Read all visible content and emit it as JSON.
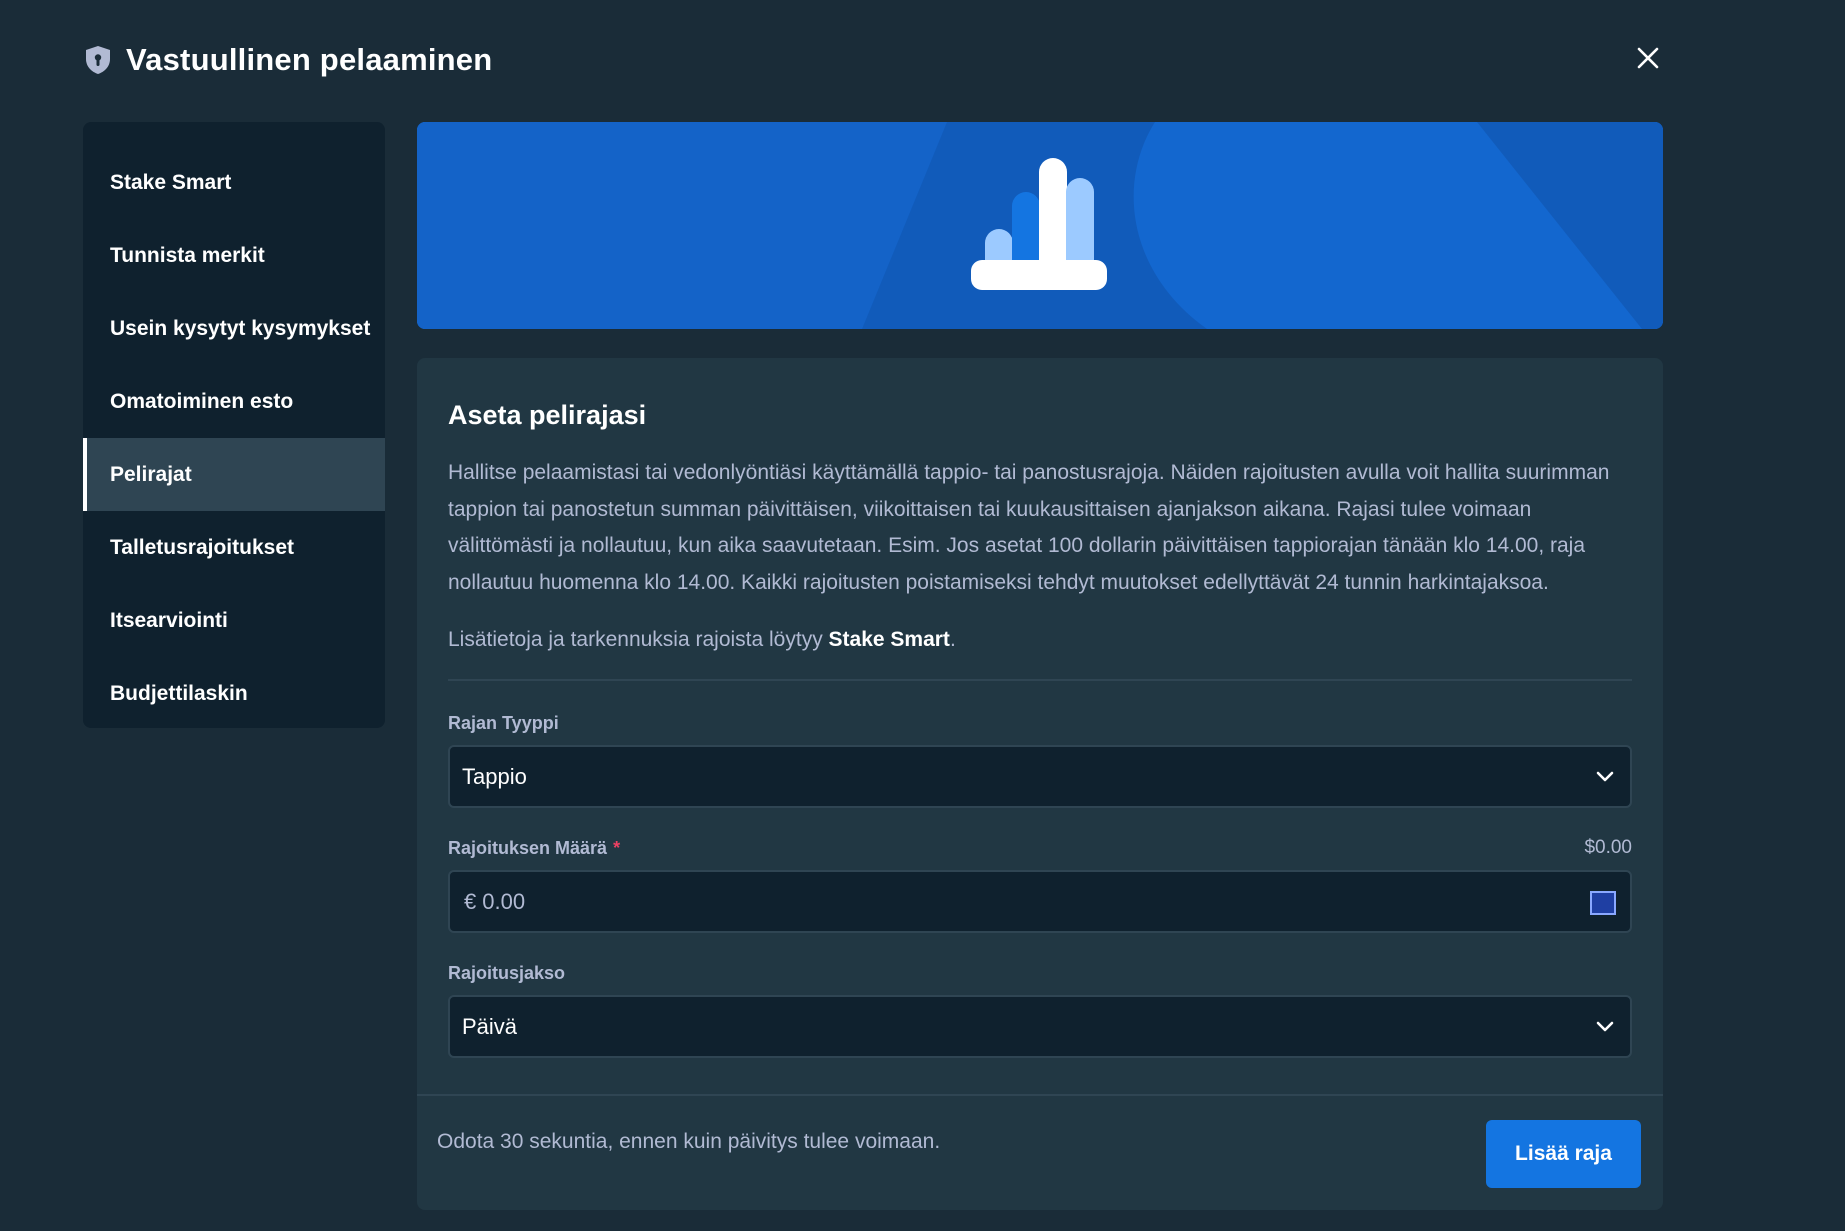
{
  "header": {
    "title": "Vastuullinen pelaaminen",
    "icon": "shield-icon",
    "close_icon": "close-icon"
  },
  "sidebar": {
    "items": [
      {
        "label": "Stake Smart",
        "active": false
      },
      {
        "label": "Tunnista merkit",
        "active": false
      },
      {
        "label": "Usein kysytyt kysymykset",
        "active": false
      },
      {
        "label": "Omatoiminen esto",
        "active": false
      },
      {
        "label": "Pelirajat",
        "active": true
      },
      {
        "label": "Talletusrajoitukset",
        "active": false
      },
      {
        "label": "Itsearviointi",
        "active": false
      },
      {
        "label": "Budjettilaskin",
        "active": false
      }
    ]
  },
  "banner": {
    "icon": "bar-chart-icon"
  },
  "panel": {
    "title": "Aseta pelirajasi",
    "description": "Hallitse pelaamistasi tai vedonlyöntiäsi käyttämällä tappio- tai panostusrajoja. Näiden rajoitusten avulla voit hallita suurimman tappion tai panostetun summan päivittäisen, viikoittaisen tai kuukausittaisen ajanjakson aikana. Rajasi tulee voimaan välittömästi ja nollautuu, kun aika saavutetaan. Esim. Jos asetat 100 dollarin päivittäisen tappiorajan tänään klo 14.00, raja nollautuu huomenna klo 14.00. Kaikki rajoitusten poistamiseksi tehdyt muutokset edellyttävät 24 tunnin harkintajaksoa.",
    "more_prefix": "Lisätietoja ja tarkennuksia rajoista löytyy ",
    "more_link": "Stake Smart",
    "more_suffix": ".",
    "limit_type": {
      "label": "Rajan Tyyppi",
      "value": "Tappio"
    },
    "amount": {
      "label": "Rajoituksen Määrä",
      "required_mark": "*",
      "converted": "$0.00",
      "currency_symbol": "€",
      "placeholder": "0.00",
      "currency_icon": "eu-flag-icon"
    },
    "period": {
      "label": "Rajoitusjakso",
      "value": "Päivä"
    },
    "footer_text": "Odota 30 sekuntia, ennen kuin päivitys tulee voimaan.",
    "submit_label": "Lisää raja"
  },
  "colors": {
    "background": "#1a2c38",
    "panel": "#213743",
    "sidebar": "#0f212e",
    "accent": "#1475e1",
    "banner": "#1367cf"
  }
}
